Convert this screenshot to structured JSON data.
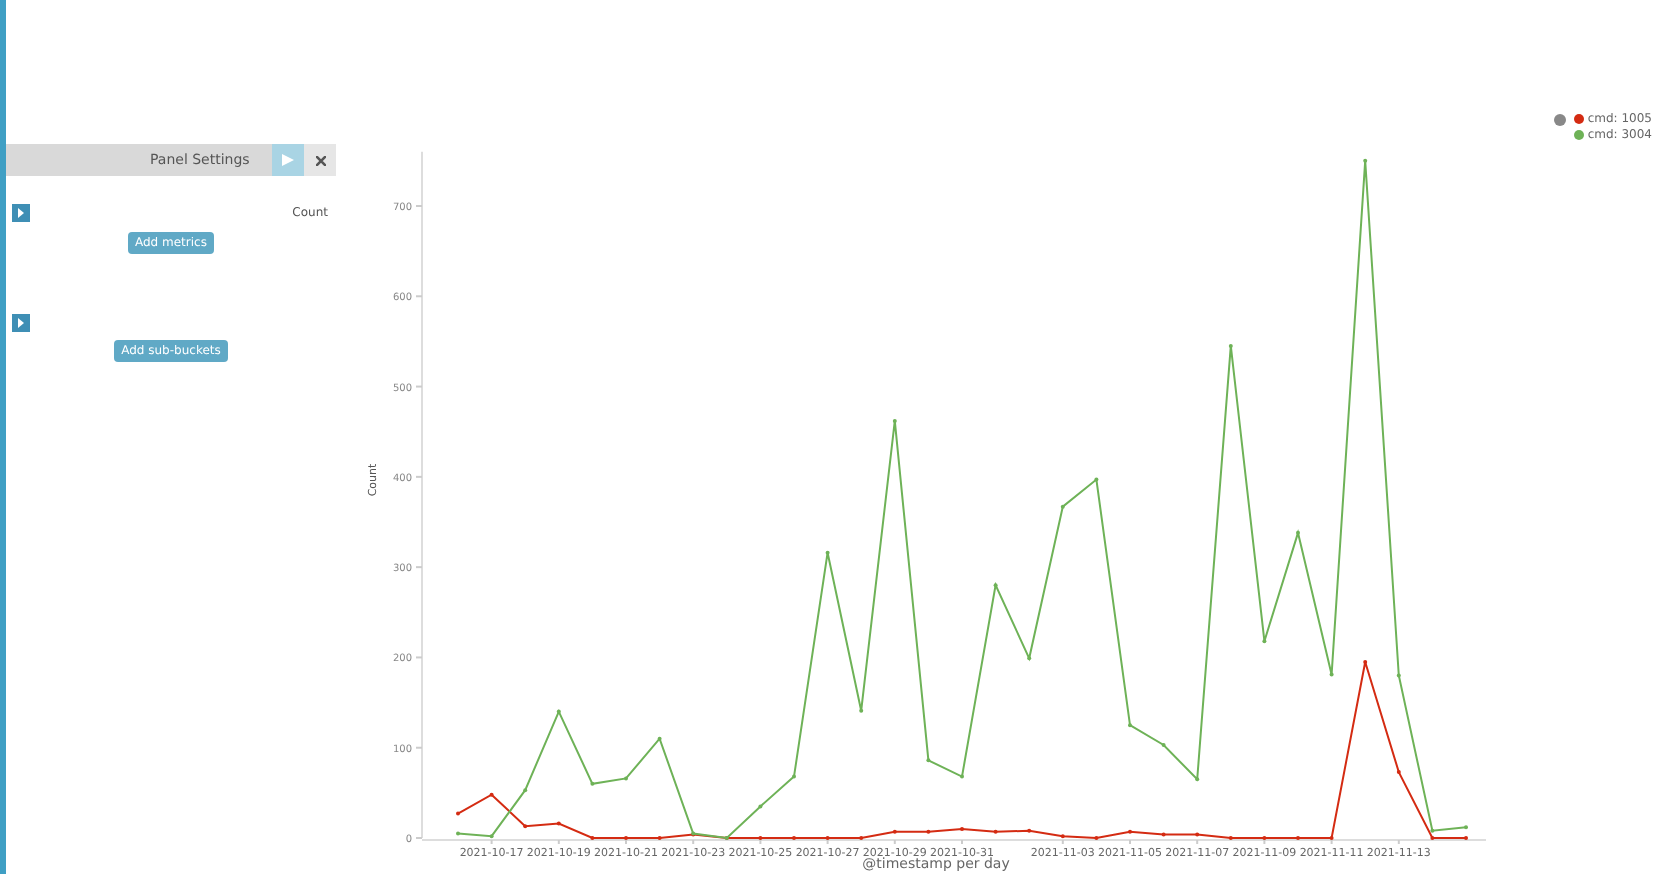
{
  "panel": {
    "tab": "Panel Settings",
    "metrics": [
      {
        "label": "Count",
        "expanded": false
      }
    ],
    "add_metrics": "Add metrics",
    "add_buckets": "Add sub-buckets"
  },
  "chart_data": {
    "type": "line",
    "xlabel": "@timestamp per day",
    "ylabel": "Count",
    "categories": [
      null,
      "2021-10-17",
      null,
      "2021-10-19",
      null,
      "2021-10-21",
      null,
      "2021-10-23",
      null,
      "2021-10-25",
      null,
      "2021-10-27",
      null,
      "2021-10-29",
      null,
      "2021-10-31",
      null,
      null,
      "2021-11-03",
      null,
      "2021-11-05",
      null,
      "2021-11-07",
      null,
      "2021-11-09",
      null,
      "2021-11-11",
      null,
      "2021-11-13",
      null,
      null
    ],
    "yticks": [
      0,
      100,
      200,
      300,
      400,
      500,
      600,
      700
    ],
    "ylim": [
      0,
      760
    ],
    "series": [
      {
        "name": "cmd: 1005",
        "color": "#d42b12",
        "values": [
          27,
          48,
          13,
          16,
          0,
          0,
          0,
          4,
          0,
          0,
          0,
          0,
          0,
          7,
          7,
          10,
          7,
          8,
          2,
          0,
          7,
          4,
          4,
          0,
          0,
          0,
          0,
          195,
          73,
          0,
          0
        ]
      },
      {
        "name": "cmd: 3004",
        "color": "#6eb257",
        "values": [
          5,
          2,
          53,
          140,
          60,
          66,
          110,
          5,
          0,
          35,
          68,
          316,
          141,
          462,
          86,
          68,
          280,
          199,
          367,
          397,
          125,
          103,
          65,
          545,
          218,
          338,
          181,
          750,
          180,
          8,
          12
        ]
      }
    ]
  }
}
